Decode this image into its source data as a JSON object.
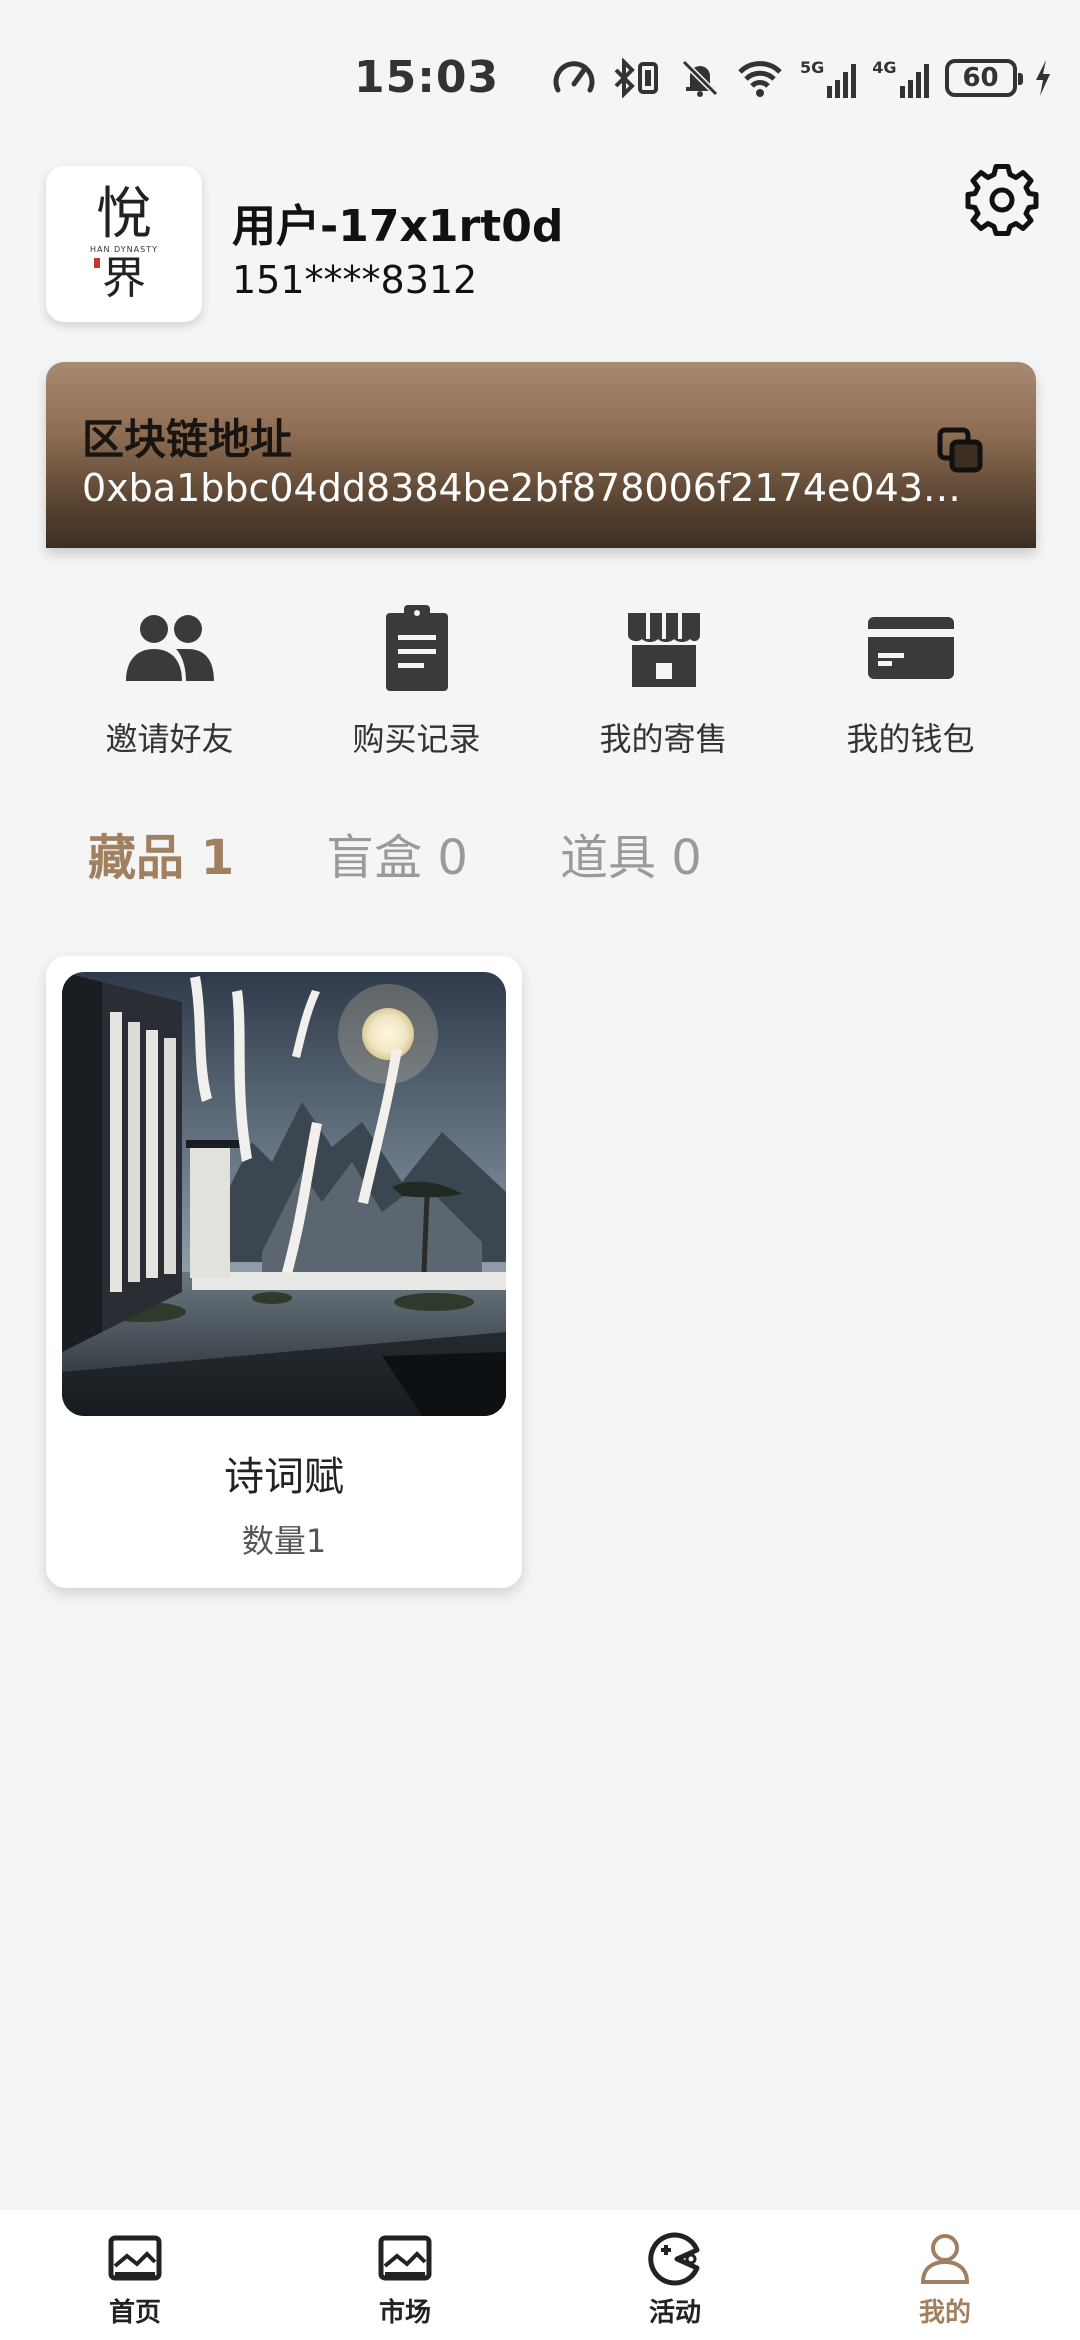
{
  "status_bar": {
    "time": "15:03",
    "battery": "60",
    "network_5g": "5G",
    "network_4g": "4G",
    "icons": [
      "speed-icon",
      "bluetooth-icon",
      "vibrate-icon",
      "mute-bell-icon",
      "wifi-icon",
      "signal-5g-icon",
      "signal-4g-icon",
      "battery-icon",
      "charging-icon"
    ]
  },
  "profile": {
    "avatar_logo_top": "悅",
    "avatar_logo_mid": "HAN DYNASTY",
    "avatar_logo_bottom": "界",
    "username": "用户-17x1rt0d",
    "phone": "151****8312"
  },
  "chain": {
    "title": "区块链地址",
    "address": "0xba1bbc04dd8384be2bf878006f2174e043…"
  },
  "actions": [
    {
      "label": "邀请好友",
      "icon": "people-icon"
    },
    {
      "label": "购买记录",
      "icon": "clipboard-icon"
    },
    {
      "label": "我的寄售",
      "icon": "store-icon"
    },
    {
      "label": "我的钱包",
      "icon": "card-icon"
    }
  ],
  "tabs": [
    {
      "label": "藏品 1",
      "active": true
    },
    {
      "label": "盲盒 0",
      "active": false
    },
    {
      "label": "道具 0",
      "active": false
    }
  ],
  "items": [
    {
      "name": "诗词赋",
      "quantity": "数量1"
    }
  ],
  "bottom_nav": [
    {
      "label": "首页",
      "icon": "home-picture-icon"
    },
    {
      "label": "市场",
      "icon": "market-picture-icon"
    },
    {
      "label": "活动",
      "icon": "activity-icon"
    },
    {
      "label": "我的",
      "icon": "user-icon",
      "active": true
    }
  ],
  "colors": {
    "accent": "#a08060",
    "background": "#f5f5f5",
    "chain_card_top": "#a88a70",
    "chain_card_bottom": "#3d2e22",
    "icon_dark": "#3a3a3a"
  }
}
